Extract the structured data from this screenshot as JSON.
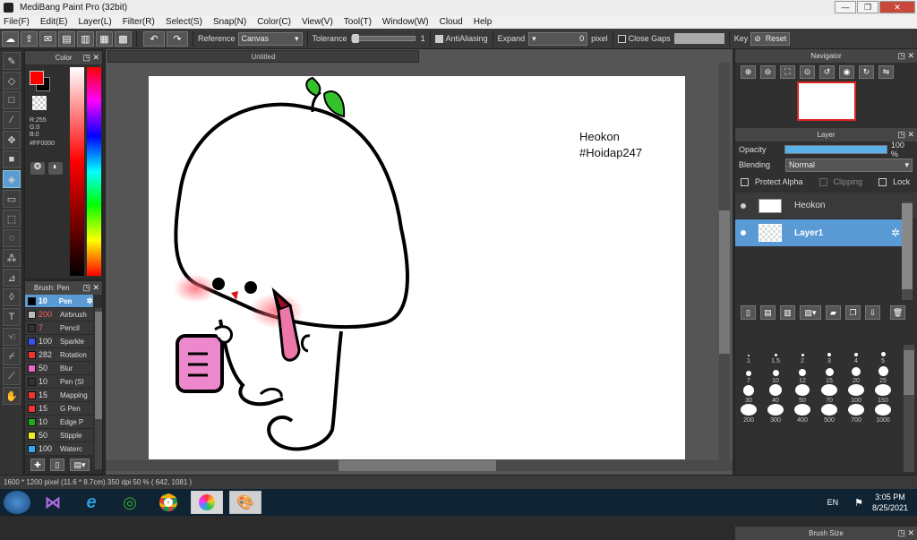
{
  "window": {
    "title": "MediBang Paint Pro (32bit)",
    "min": "—",
    "max": "❐",
    "close": "✕"
  },
  "menu": [
    "File(F)",
    "Edit(E)",
    "Layer(L)",
    "Filter(R)",
    "Select(S)",
    "Snap(N)",
    "Color(C)",
    "View(V)",
    "Tool(T)",
    "Window(W)",
    "Cloud",
    "Help"
  ],
  "toolbar": {
    "reference_label": "Reference",
    "reference_value": "Canvas",
    "tolerance_label": "Tolerance",
    "tolerance_value": "1",
    "antialiasing_label": "AntiAliasing",
    "expand_label": "Expand",
    "expand_value": "0",
    "expand_unit": "pixel",
    "close_gaps_label": "Close Gaps",
    "key_label": "Key",
    "reset_label": "Reset"
  },
  "color_panel": {
    "title": "Color",
    "primary": "#FF0000",
    "secondary": "#000000",
    "r": "R:255",
    "g": "G:0",
    "b": "B:0",
    "hex": "#FF0000"
  },
  "brush_panel": {
    "title": "Brush: Pen",
    "items": [
      {
        "size": "10",
        "name": "Pen",
        "color": "#000000"
      },
      {
        "size": "200",
        "name": "Airbrush",
        "color": "#bbbbbb"
      },
      {
        "size": "7",
        "name": "Pencil",
        "color": "#333333"
      },
      {
        "size": "100",
        "name": "Sparkle",
        "color": "#3355ee"
      },
      {
        "size": "282",
        "name": "Rotation",
        "color": "#ee3333"
      },
      {
        "size": "50",
        "name": "Blur",
        "color": "#ee66cc"
      },
      {
        "size": "10",
        "name": "Pen (Sl",
        "color": "#333333"
      },
      {
        "size": "15",
        "name": "Mapping",
        "color": "#ee3333"
      },
      {
        "size": "15",
        "name": "G Pen",
        "color": "#ee3333"
      },
      {
        "size": "10",
        "name": "Edge P",
        "color": "#22aa22"
      },
      {
        "size": "50",
        "name": "Stipple",
        "color": "#eeee22"
      },
      {
        "size": "100",
        "name": "Waterc",
        "color": "#33aaee"
      }
    ]
  },
  "document": {
    "tab": "Untitled",
    "canvas_text_1": "Heokon",
    "canvas_text_2": "#Hoidap247"
  },
  "navigator": {
    "title": "Navigator"
  },
  "layer_panel": {
    "title": "Layer",
    "opacity_label": "Opacity",
    "opacity_value": "100 %",
    "opacity_fraction": 1.0,
    "blending_label": "Blending",
    "blending_value": "Normal",
    "protect_alpha": "Protect Alpha",
    "clipping": "Clipping",
    "lock": "Lock",
    "layers": [
      {
        "name": "Heokon",
        "selected": false
      },
      {
        "name": "Layer1",
        "selected": true
      }
    ]
  },
  "brush_size": {
    "title": "Brush Size",
    "sizes": [
      "1",
      "1.5",
      "2",
      "3",
      "4",
      "5",
      "7",
      "10",
      "12",
      "15",
      "20",
      "25",
      "30",
      "40",
      "50",
      "70",
      "100",
      "150",
      "200",
      "300",
      "400",
      "500",
      "700",
      "1000"
    ]
  },
  "status": {
    "text": "1600 * 1200 pixel   (11.6 * 8.7cm)   350 dpi   50 %   ( 642, 1081 )"
  },
  "taskbar": {
    "lang": "EN",
    "time": "3:05 PM",
    "date": "8/25/2021"
  }
}
